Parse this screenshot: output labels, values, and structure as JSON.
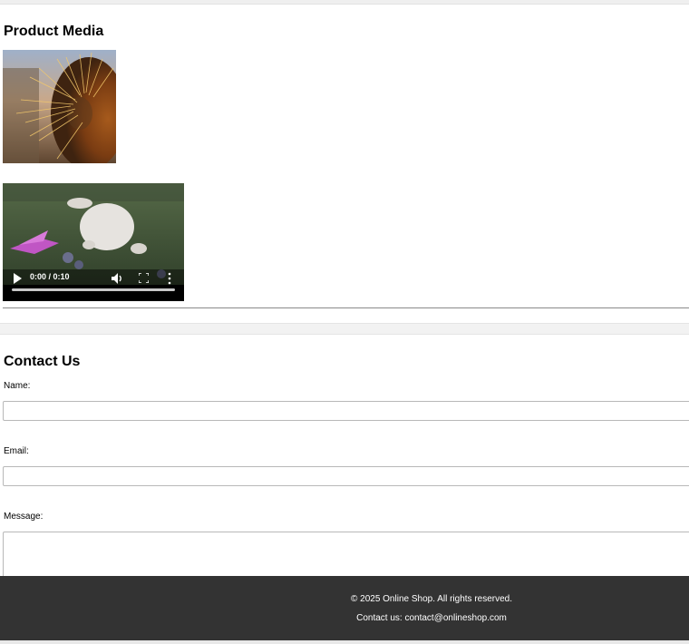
{
  "media_section": {
    "title": "Product Media",
    "image_subject": "cactus-closeup",
    "video": {
      "time": "0:00 / 0:10",
      "progress": 0
    }
  },
  "contact_section": {
    "title": "Contact Us",
    "name_label": "Name:",
    "name_value": "",
    "email_label": "Email:",
    "email_value": "",
    "message_label": "Message:",
    "message_value": ""
  },
  "footer": {
    "copyright": "© 2025 Online Shop. All rights reserved.",
    "contact": "Contact us: contact@onlineshop.com"
  },
  "colors": {
    "footer_bg": "#333333",
    "footer_text": "#ffffff"
  },
  "icons": [
    "play-icon",
    "volume-icon",
    "fullscreen-icon",
    "more-options-icon"
  ]
}
